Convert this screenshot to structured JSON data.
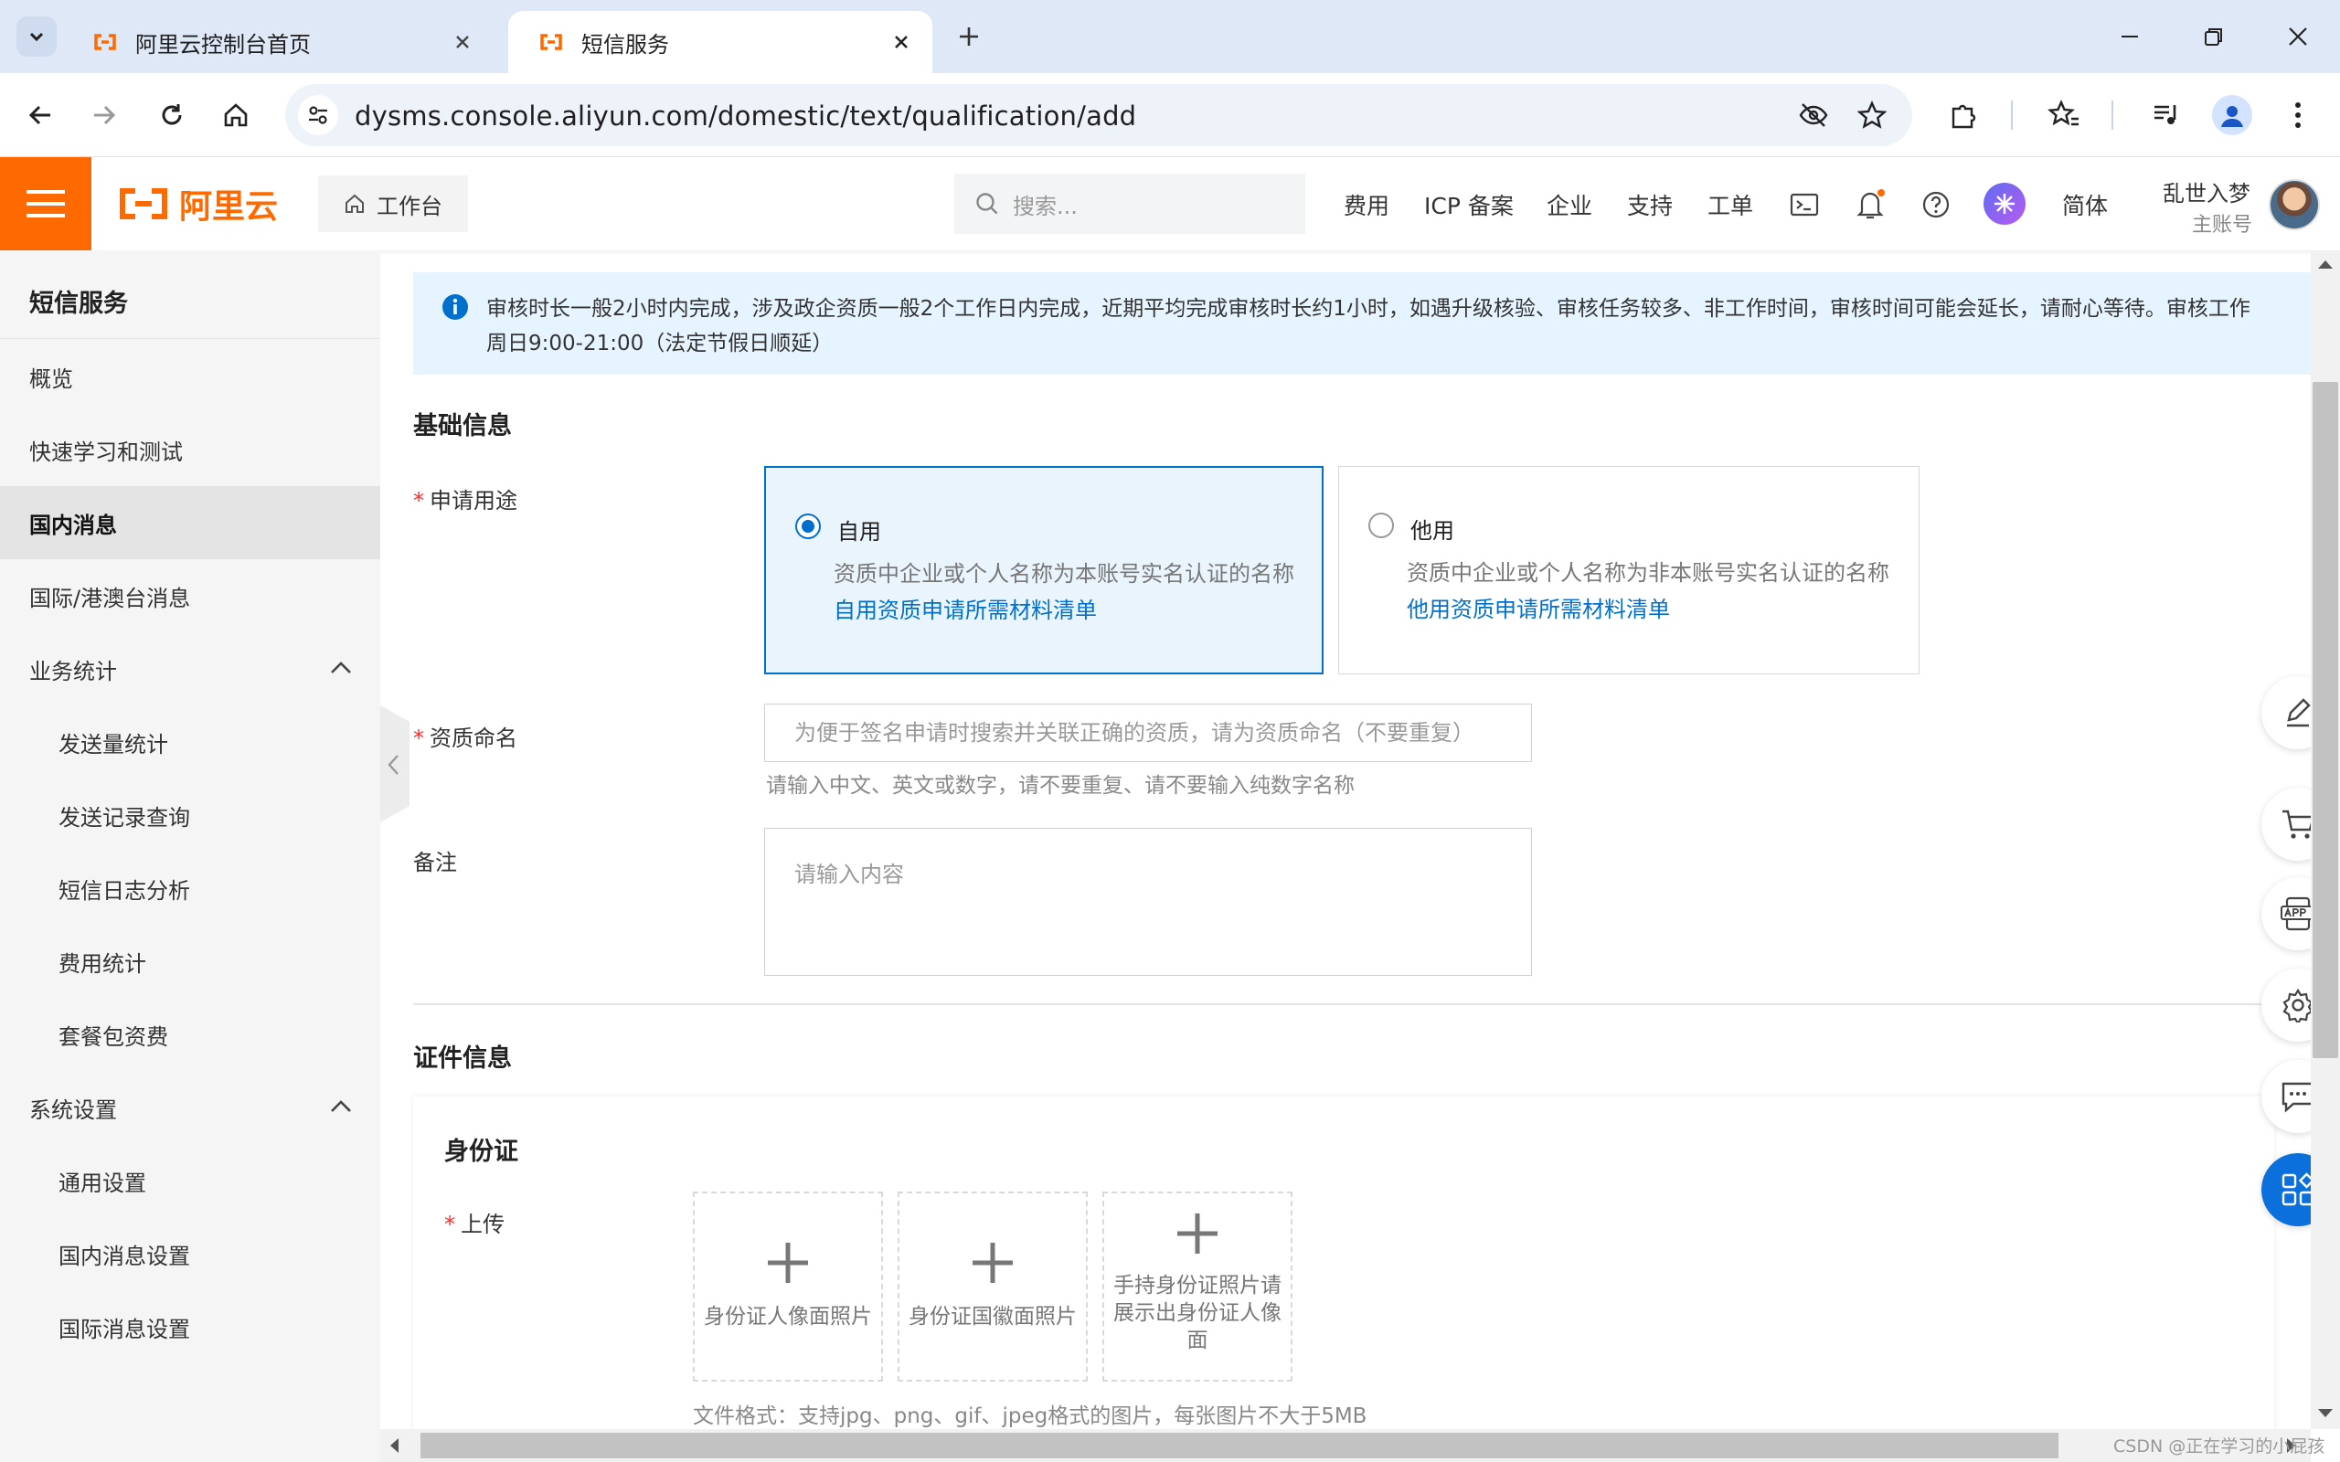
{
  "browser": {
    "tabs": [
      {
        "title": "阿里云控制台首页",
        "active": false
      },
      {
        "title": "短信服务",
        "active": true
      }
    ],
    "url": "dysms.console.aliyun.com/domestic/text/qualification/add"
  },
  "header": {
    "logo": "阿里云",
    "workbench": "工作台",
    "search_placeholder": "搜索...",
    "nav": [
      "费用",
      "ICP 备案",
      "企业",
      "支持",
      "工单"
    ],
    "lang": "简体",
    "user_name": "乱世入梦",
    "user_role": "主账号",
    "accent": "#ff6a00"
  },
  "sidebar": {
    "title": "短信服务",
    "items": [
      {
        "label": "概览",
        "level": 0
      },
      {
        "label": "快速学习和测试",
        "level": 0
      },
      {
        "label": "国内消息",
        "level": 0,
        "active": true
      },
      {
        "label": "国际/港澳台消息",
        "level": 0
      },
      {
        "label": "业务统计",
        "level": 0,
        "expanded": true
      },
      {
        "label": "发送量统计",
        "level": 1
      },
      {
        "label": "发送记录查询",
        "level": 1
      },
      {
        "label": "短信日志分析",
        "level": 1
      },
      {
        "label": "费用统计",
        "level": 1
      },
      {
        "label": "套餐包资费",
        "level": 1
      },
      {
        "label": "系统设置",
        "level": 0,
        "expanded": true
      },
      {
        "label": "通用设置",
        "level": 1
      },
      {
        "label": "国内消息设置",
        "level": 1
      },
      {
        "label": "国际消息设置",
        "level": 1
      }
    ]
  },
  "notice": {
    "line1": "审核时长一般2小时内完成，涉及政企资质一般2个工作日内完成，近期平均完成审核时长约1小时，如遇升级核验、审核任务较多、非工作时间，审核时间可能会延长，请耐心等待。审核工作",
    "line2": "周日9:00-21:00（法定节假日顺延）"
  },
  "form": {
    "basic_title": "基础信息",
    "purpose_label": "申请用途",
    "options": [
      {
        "title": "自用",
        "desc": "资质中企业或个人名称为本账号实名认证的名称",
        "link": "自用资质申请所需材料清单",
        "selected": true
      },
      {
        "title": "他用",
        "desc": "资质中企业或个人名称为非本账号实名认证的名称",
        "link": "他用资质申请所需材料清单",
        "selected": false
      }
    ],
    "name_label": "资质命名",
    "name_placeholder": "为便于签名申请时搜索并关联正确的资质，请为资质命名（不要重复）",
    "name_hint": "请输入中文、英文或数字，请不要重复、请不要输入纯数字名称",
    "remark_label": "备注",
    "remark_placeholder": "请输入内容",
    "cert_title": "证件信息",
    "idcard_title": "身份证",
    "upload_label": "上传",
    "uploads": [
      "身份证人像面照片",
      "身份证国徽面照片",
      "手持身份证照片请展示出身份证人像面"
    ],
    "file_format": "文件格式：支持jpg、png、gif、jpeg格式的图片，每张图片不大于5MB"
  },
  "watermark": "CSDN @正在学习的小屁孩"
}
